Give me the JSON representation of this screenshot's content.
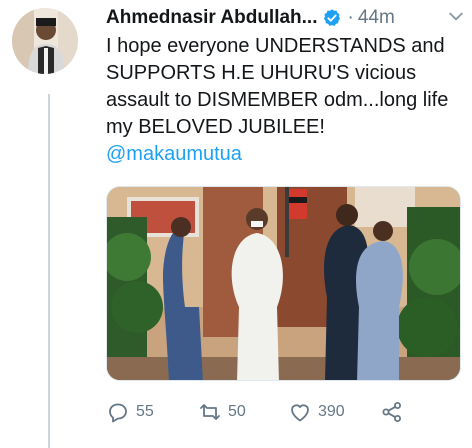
{
  "tweet": {
    "author_name": "Ahmednasir Abdullah...",
    "separator": "·",
    "time": "44m",
    "text_main": "I hope everyone UNDERSTANDS and SUPPORTS H.E UHURU'S vicious assault to DISMEMBER odm...long life my BELOVED JUBILEE! ",
    "mention": "@makaumutua"
  },
  "actions": {
    "replies": "55",
    "retweets": "50",
    "likes": "390"
  },
  "icons": {
    "verified": "verified-badge-icon",
    "more": "chevron-down-icon",
    "reply": "reply-icon",
    "retweet": "retweet-icon",
    "like": "heart-icon",
    "share": "share-icon"
  },
  "colors": {
    "accent": "#1da1f2",
    "muted": "#657786",
    "text": "#14171a"
  }
}
